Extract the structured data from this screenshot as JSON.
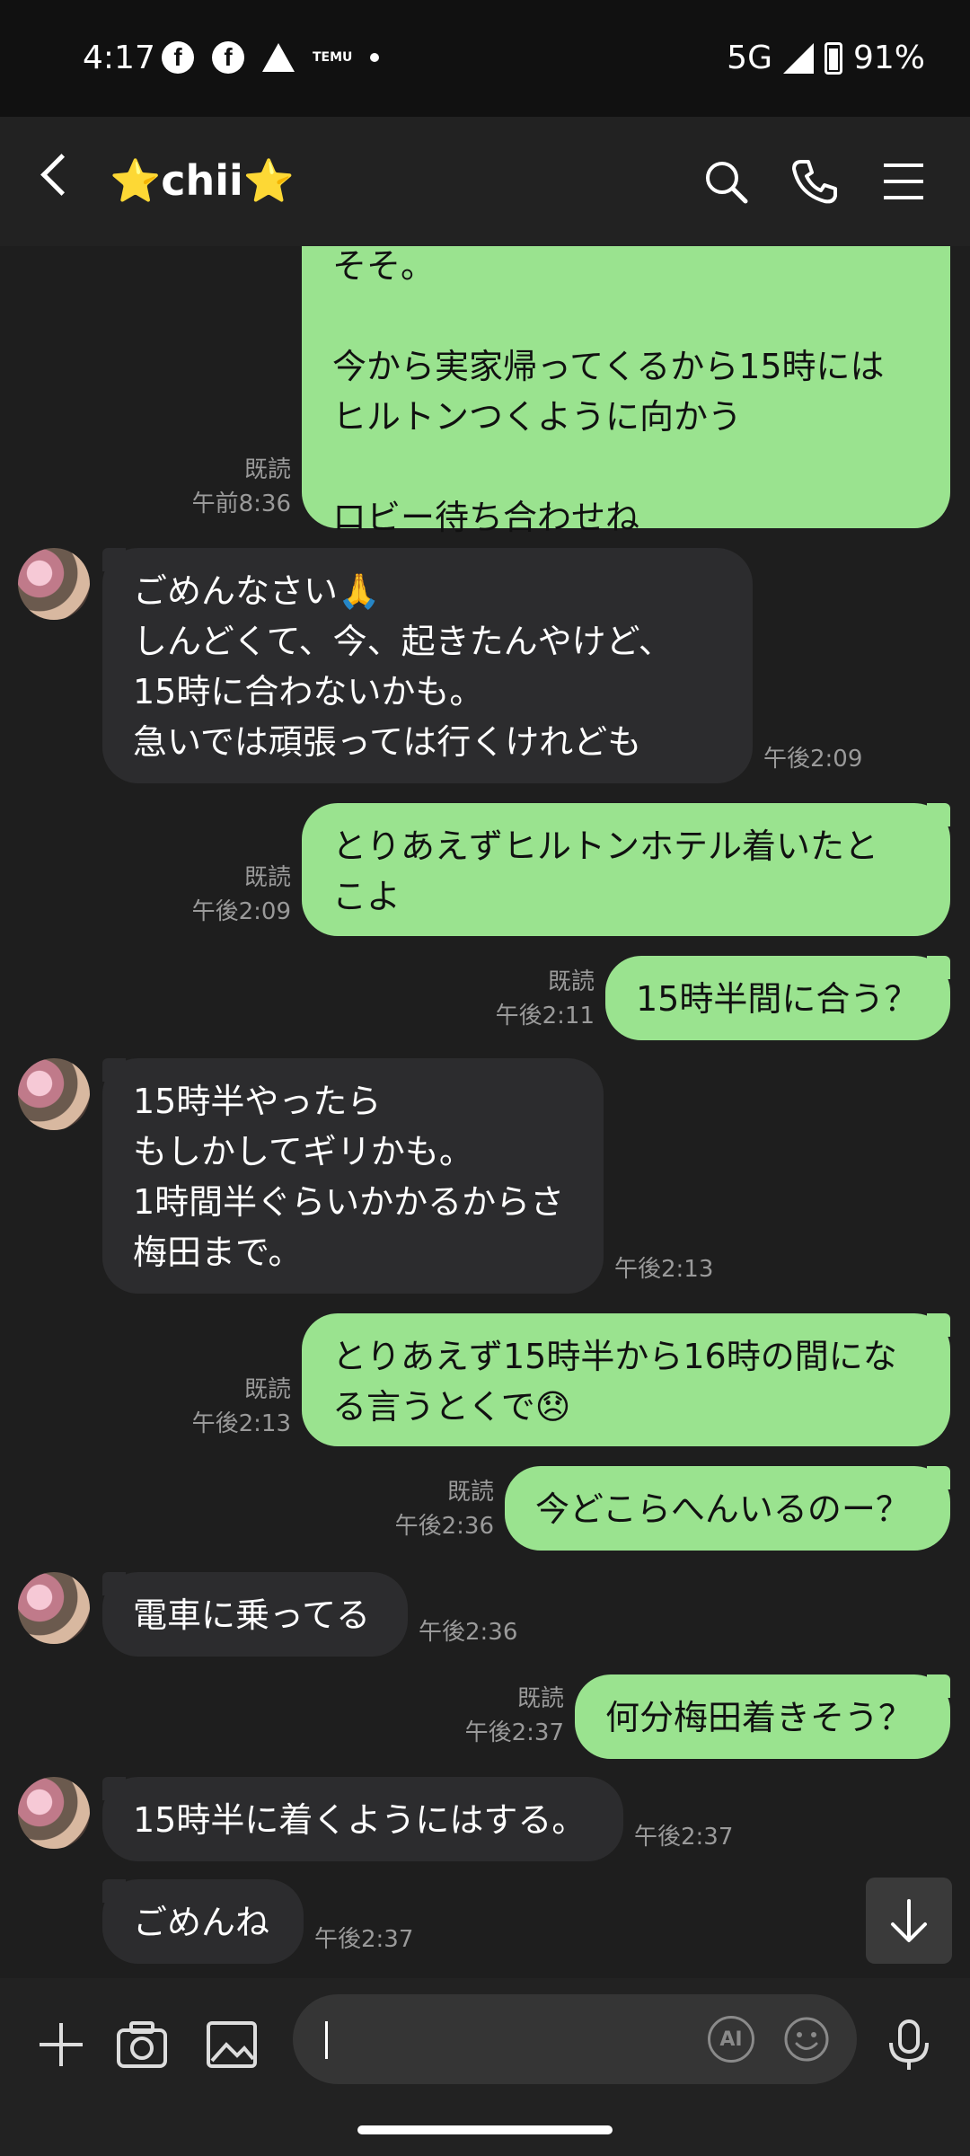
{
  "status_bar": {
    "time": "4:17",
    "network": "5G",
    "battery": "91%",
    "notification_icons": [
      "facebook-icon",
      "facebook-icon",
      "warning-icon",
      "temu-icon"
    ],
    "temu_label": "TEMU"
  },
  "header": {
    "title": "⭐chii⭐"
  },
  "messages": [
    {
      "dir": "sent",
      "text": "そそ。\n\n今から実家帰ってくるから15時には\nヒルトンつくように向かう\n\nロビー待ち合わせね",
      "read": "既読",
      "time": "午前8:36"
    },
    {
      "dir": "recv",
      "text": "ごめんなさい🙏\nしんどくて、今、起きたんやけど、\n15時に合わないかも。\n急いでは頑張っては行くけれども",
      "time": "午後2:09"
    },
    {
      "dir": "sent",
      "text": "とりあえずヒルトンホテル着いたと\nこよ",
      "read": "既読",
      "time": "午後2:09"
    },
    {
      "dir": "sent",
      "text": "15時半間に合う？",
      "read": "既読",
      "time": "午後2:11"
    },
    {
      "dir": "recv",
      "text": "15時半やったら\nもしかしてギリかも。\n1時間半ぐらいかかるからさ\n梅田まで。",
      "time": "午後2:13"
    },
    {
      "dir": "sent",
      "text": "とりあえず15時半から16時の間にな\nる言うとくで😞",
      "read": "既読",
      "time": "午後2:13"
    },
    {
      "dir": "sent",
      "text": "今どこらへんいるのー？",
      "read": "既読",
      "time": "午後2:36"
    },
    {
      "dir": "recv",
      "text": "電車に乗ってる",
      "time": "午後2:36"
    },
    {
      "dir": "sent",
      "text": "何分梅田着きそう？",
      "read": "既読",
      "time": "午後2:37"
    },
    {
      "dir": "recv",
      "text": "15時半に着くようにはする。",
      "time": "午後2:37"
    },
    {
      "dir": "recv",
      "text": "ごめんね",
      "time": "午後2:37"
    }
  ],
  "input_bar": {
    "text_value": "",
    "ai_label": "AI"
  },
  "colors": {
    "sent_bubble": "#9ae38f",
    "recv_bubble": "#2c2c2e",
    "background": "#1e1e1e"
  }
}
